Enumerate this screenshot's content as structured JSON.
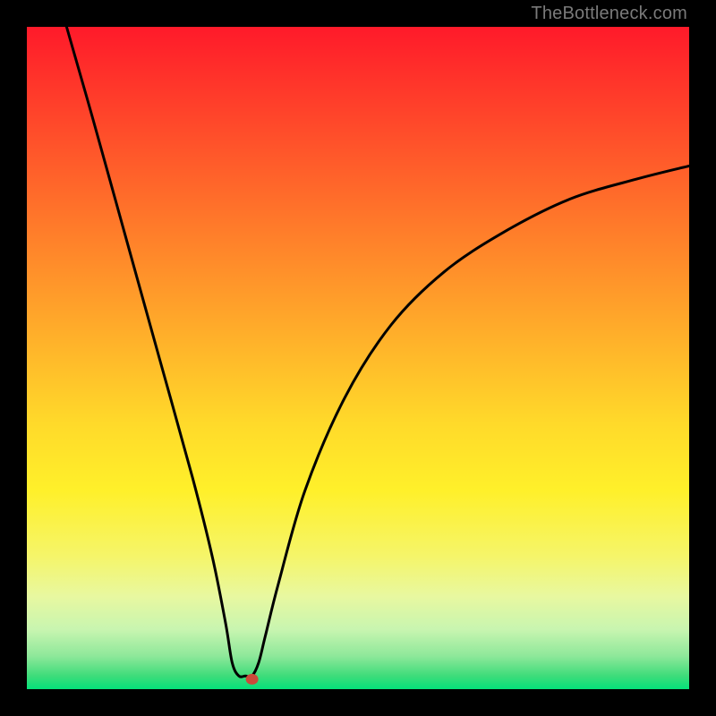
{
  "watermark": "TheBottleneck.com",
  "chart_data": {
    "type": "line",
    "title": "",
    "xlabel": "",
    "ylabel": "",
    "xlim": [
      0,
      100
    ],
    "ylim": [
      0,
      100
    ],
    "grid": false,
    "series": [
      {
        "name": "curve",
        "color": "#000000",
        "points": [
          {
            "x": 6,
            "y": 100
          },
          {
            "x": 10,
            "y": 86
          },
          {
            "x": 15,
            "y": 68
          },
          {
            "x": 20,
            "y": 50
          },
          {
            "x": 25,
            "y": 32
          },
          {
            "x": 28,
            "y": 20
          },
          {
            "x": 30,
            "y": 10
          },
          {
            "x": 31,
            "y": 4
          },
          {
            "x": 32,
            "y": 2
          },
          {
            "x": 33,
            "y": 2
          },
          {
            "x": 34,
            "y": 2
          },
          {
            "x": 35,
            "y": 4
          },
          {
            "x": 36,
            "y": 8
          },
          {
            "x": 38,
            "y": 16
          },
          {
            "x": 42,
            "y": 30
          },
          {
            "x": 48,
            "y": 44
          },
          {
            "x": 55,
            "y": 55
          },
          {
            "x": 63,
            "y": 63
          },
          {
            "x": 72,
            "y": 69
          },
          {
            "x": 82,
            "y": 74
          },
          {
            "x": 92,
            "y": 77
          },
          {
            "x": 100,
            "y": 79
          }
        ]
      }
    ],
    "marker": {
      "name": "minimum-marker",
      "x": 34,
      "y": 1.5,
      "color": "#cc4a3a",
      "rx": 7,
      "ry": 6
    }
  }
}
